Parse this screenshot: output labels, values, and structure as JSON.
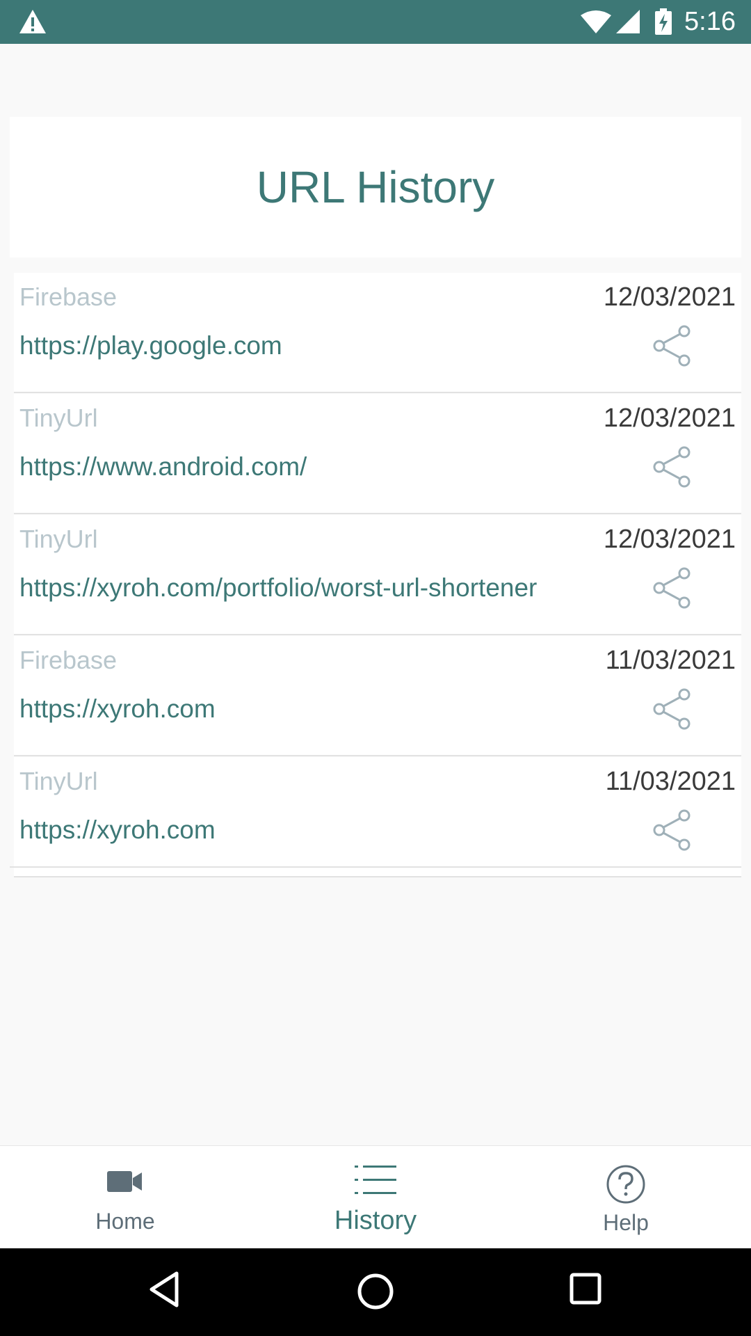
{
  "status_bar": {
    "time": "5:16",
    "icons": [
      "warning-icon",
      "wifi-icon",
      "signal-icon",
      "battery-charging-icon"
    ]
  },
  "header": {
    "title": "URL History"
  },
  "history": [
    {
      "service": "Firebase",
      "date": "12/03/2021",
      "url": "https://play.google.com",
      "action_icon": "share-icon"
    },
    {
      "service": "TinyUrl",
      "date": "12/03/2021",
      "url": "https://www.android.com/",
      "action_icon": "share-icon"
    },
    {
      "service": "TinyUrl",
      "date": "12/03/2021",
      "url": "https://xyroh.com/portfolio/worst-url-shortener",
      "action_icon": "share-icon"
    },
    {
      "service": "Firebase",
      "date": "11/03/2021",
      "url": "https://xyroh.com",
      "action_icon": "share-icon"
    },
    {
      "service": "TinyUrl",
      "date": "11/03/2021",
      "url": "https://xyroh.com",
      "action_icon": "share-icon"
    }
  ],
  "bottom_nav": {
    "selected": "History",
    "items": [
      {
        "label": "Home",
        "icon": "video-camera-icon"
      },
      {
        "label": "History",
        "icon": "list-icon"
      },
      {
        "label": "Help",
        "icon": "help-circle-icon"
      }
    ]
  },
  "android_nav": [
    "back-icon",
    "home-circle-icon",
    "recents-icon"
  ],
  "colors": {
    "primary": "#3d7876",
    "background": "#f9f9f9",
    "service_label": "#b8c6cc",
    "date_text": "#3a3a3a",
    "share_icon": "#9fb0b8",
    "nav_inactive": "#5e6e78"
  }
}
